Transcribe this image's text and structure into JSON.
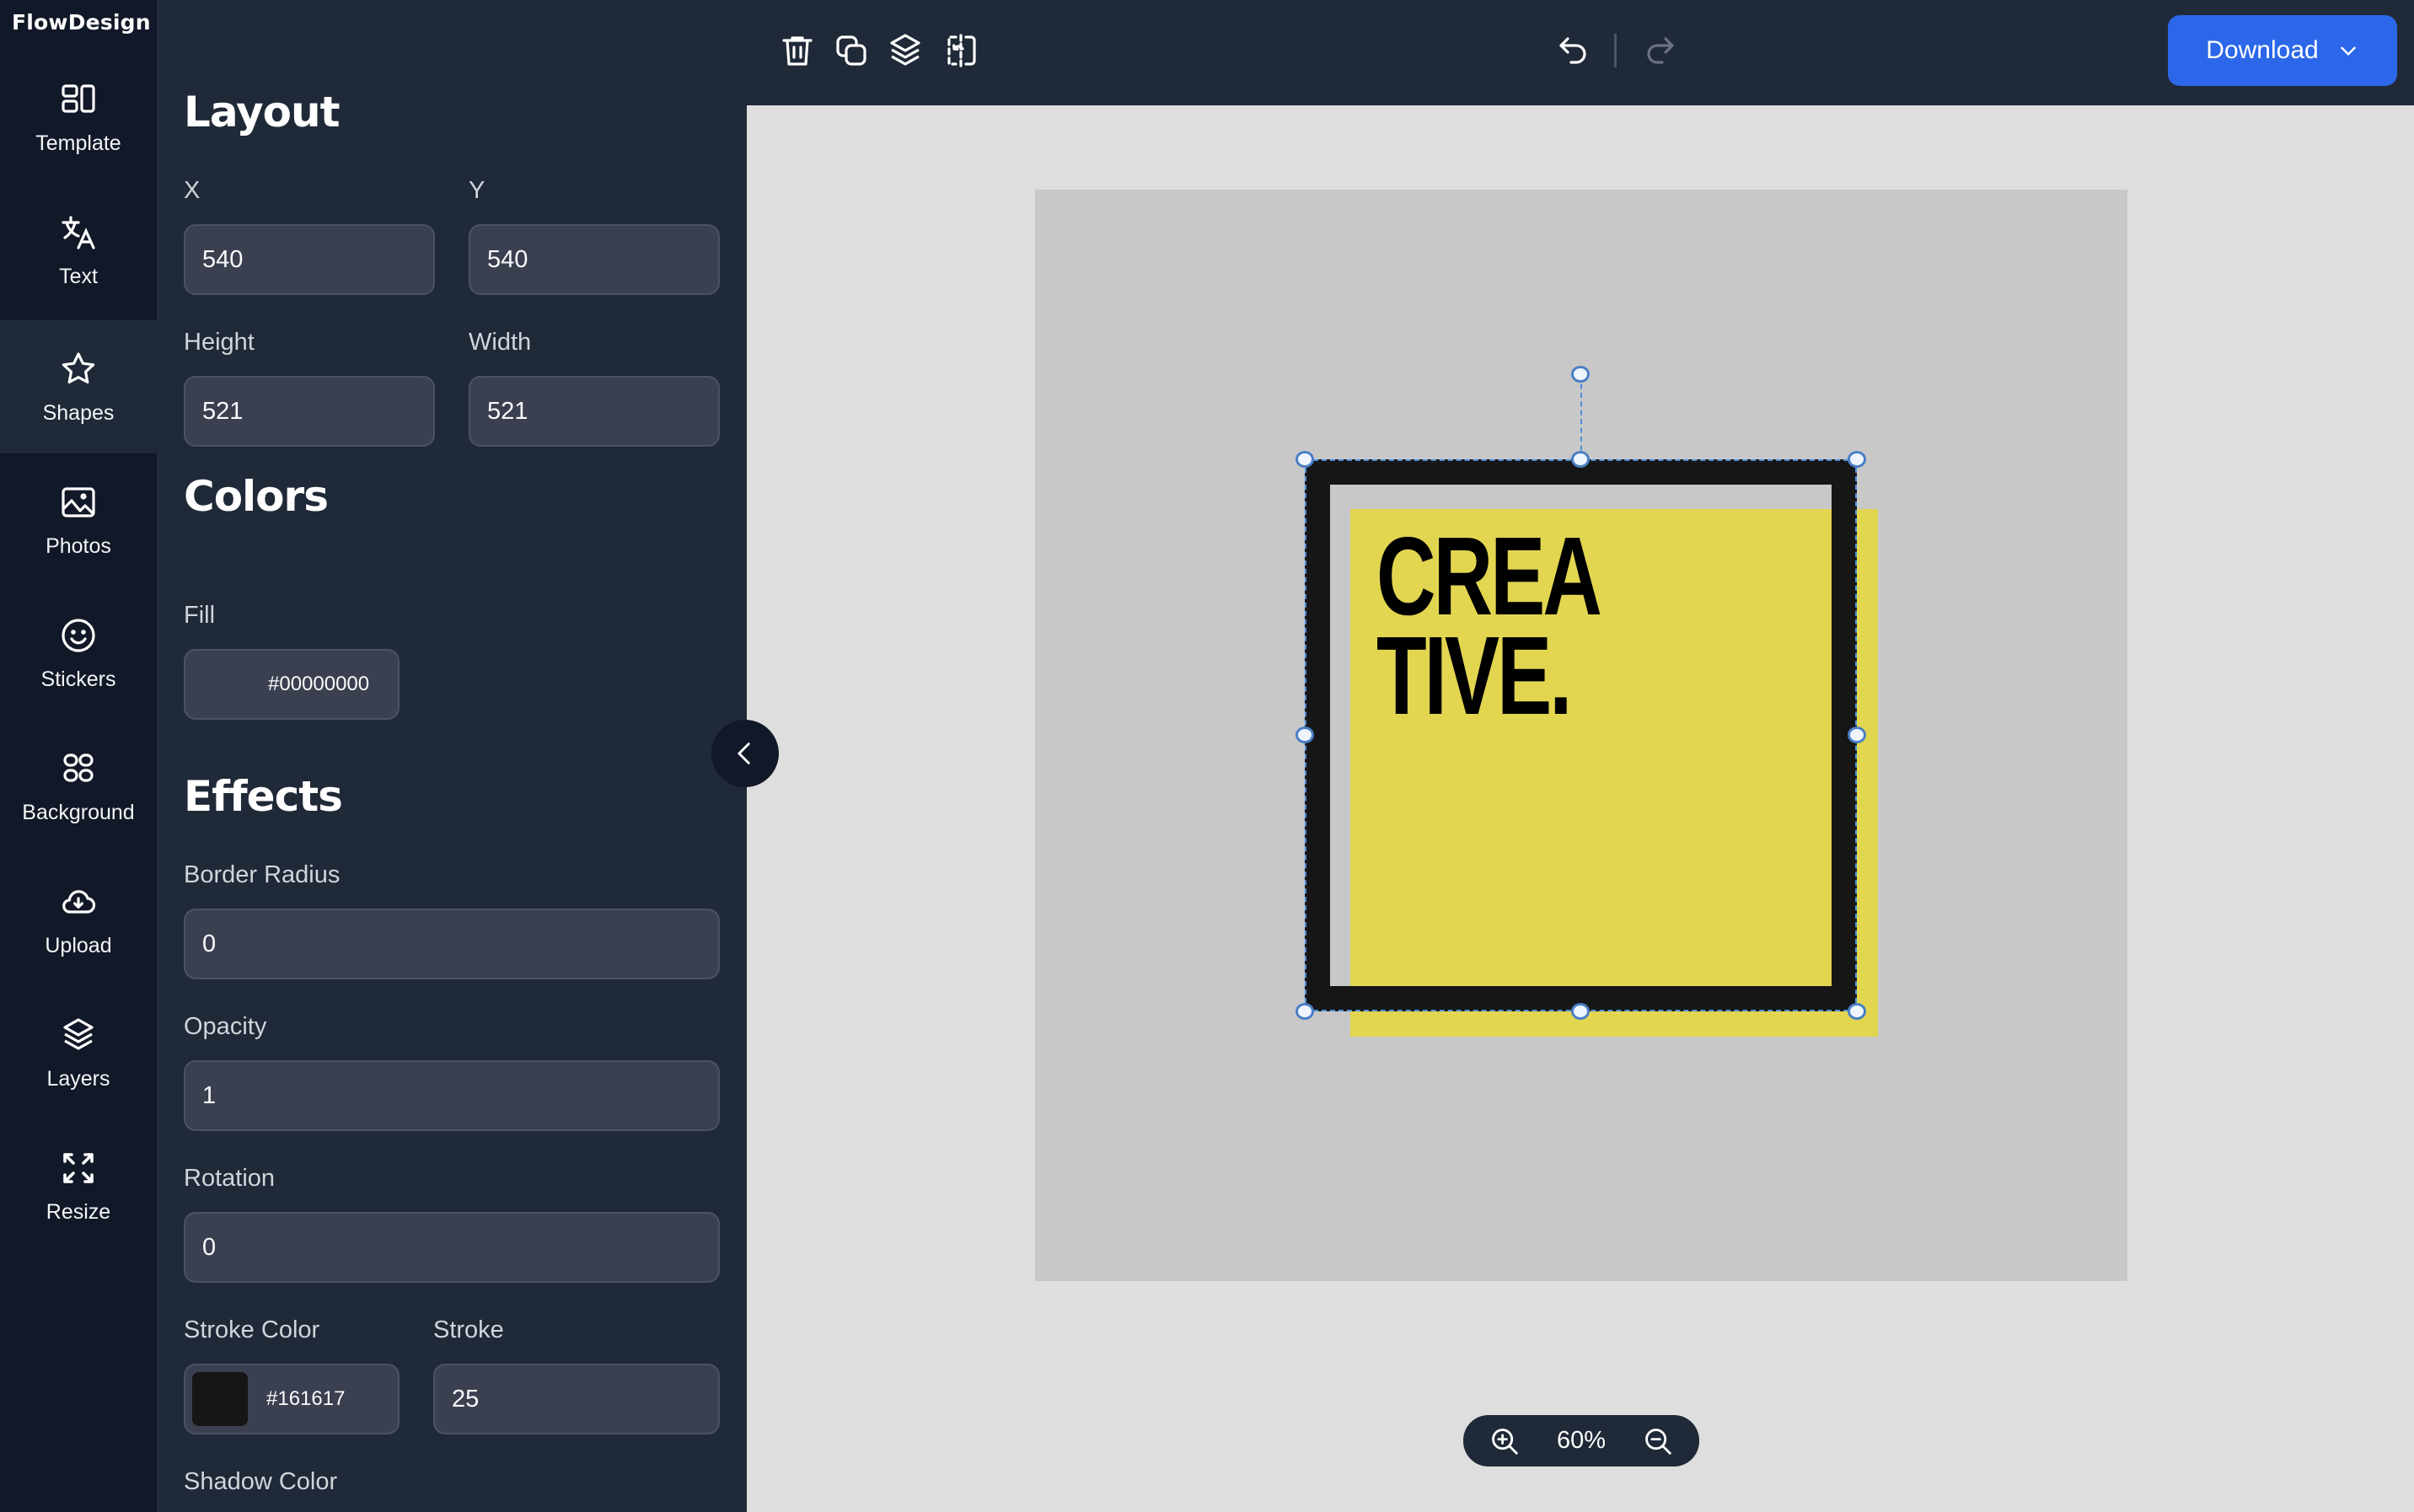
{
  "app": {
    "logo": "FlowDesign"
  },
  "sidebar": {
    "active": "Shapes",
    "items": [
      {
        "label": "Template",
        "icon": "template-icon"
      },
      {
        "label": "Text",
        "icon": "translate-text-icon"
      },
      {
        "label": "Shapes",
        "icon": "star-icon"
      },
      {
        "label": "Photos",
        "icon": "image-icon"
      },
      {
        "label": "Stickers",
        "icon": "smiley-icon"
      },
      {
        "label": "Background",
        "icon": "grid-icon"
      },
      {
        "label": "Upload",
        "icon": "cloud-upload-icon"
      },
      {
        "label": "Layers",
        "icon": "layers-icon"
      },
      {
        "label": "Resize",
        "icon": "resize-icon"
      }
    ]
  },
  "toolbar": {
    "icons": [
      "trash-icon",
      "duplicate-icon",
      "layers-icon",
      "flip-icon"
    ],
    "undo_icon": "undo-icon",
    "redo_icon": "redo-icon",
    "download_label": "Download"
  },
  "properties": {
    "layout": {
      "title": "Layout",
      "x_label": "X",
      "x_value": "540",
      "y_label": "Y",
      "y_value": "540",
      "height_label": "Height",
      "height_value": "521",
      "width_label": "Width",
      "width_value": "521"
    },
    "colors": {
      "title": "Colors",
      "fill_label": "Fill",
      "fill_value": "#00000000"
    },
    "effects": {
      "title": "Effects",
      "border_radius_label": "Border Radius",
      "border_radius_value": "0",
      "opacity_label": "Opacity",
      "opacity_value": "1",
      "rotation_label": "Rotation",
      "rotation_value": "0",
      "stroke_color_label": "Stroke Color",
      "stroke_color_value": "#161617",
      "stroke_label": "Stroke",
      "stroke_value": "25",
      "shadow_color_label": "Shadow Color"
    }
  },
  "canvas": {
    "headline": "CREA\nTIVE.",
    "artboard_color": "#c8c8c8",
    "yellow_color": "#e2d651",
    "stroke_color": "#161617",
    "zoom_level": "60%"
  },
  "colors": {
    "accent": "#2b67e8",
    "rail_bg": "#111827",
    "panel_bg": "#1f2937",
    "selection": "#4a90d9"
  }
}
